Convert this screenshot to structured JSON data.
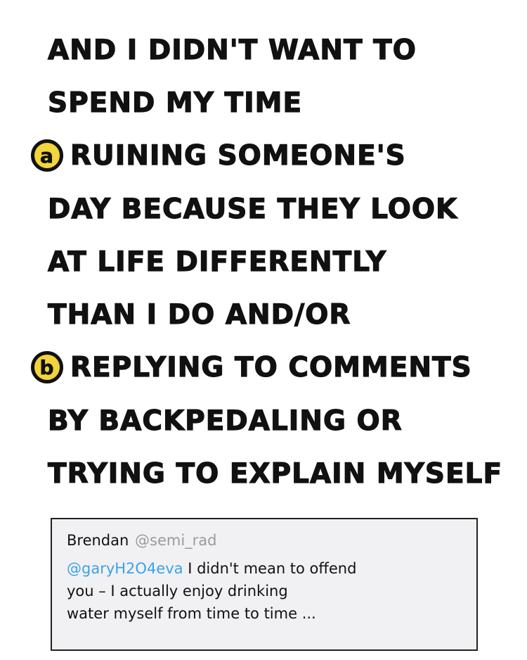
{
  "comic": {
    "lines": [
      "AND I DIDN'T WANT TO",
      "SPEND MY TIME",
      "RUINING SOMEONE'S",
      "DAY BECAUSE THEY LOOK",
      "AT LIFE DIFFERENTLY",
      "THAN I DO AND/OR",
      "REPLYING TO COMMENTS",
      "BY BACKPEDALING OR",
      "TRYING TO EXPLAIN MYSELF"
    ],
    "markers": {
      "a": "a",
      "b": "b"
    },
    "marker_color": "#f2d43c"
  },
  "tweet": {
    "name": "Brendan",
    "handle": "@semi_rad",
    "mention": "@garyH2O4eva",
    "body_line1": "I didn't mean to offend",
    "body_line2": "you – I actually enjoy drinking",
    "body_line3": "water myself from time to time ...",
    "mention_color": "#3aa3e8",
    "handle_color": "#9a9a9a",
    "background": "#f1f1f3"
  }
}
